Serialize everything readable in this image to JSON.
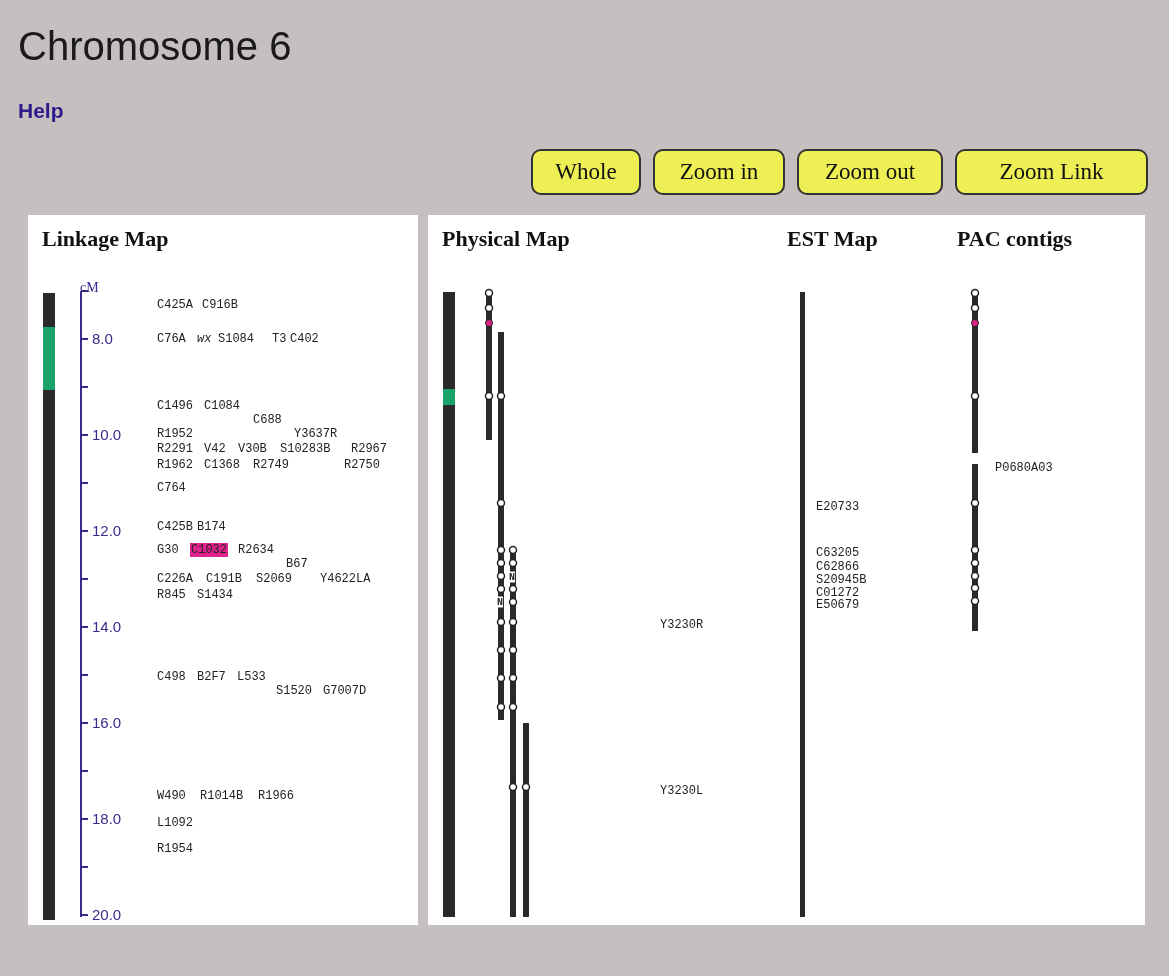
{
  "title": "Chromosome 6",
  "help_link": "Help",
  "buttons": [
    "Whole",
    "Zoom in",
    "Zoom out",
    "Zoom Link"
  ],
  "linkage_map": {
    "title": "Linkage Map",
    "axis_unit": "cM",
    "axis_labels": [
      "8.0",
      "10.0",
      "12.0",
      "14.0",
      "16.0",
      "18.0",
      "20.0"
    ],
    "marker_rows": [
      [
        {
          "label": "C425A",
          "selected": false,
          "italic": false
        },
        {
          "label": "C916B",
          "selected": false,
          "italic": false
        }
      ],
      [
        {
          "label": "C76A",
          "selected": false,
          "italic": false
        },
        {
          "label": "wx",
          "selected": false,
          "italic": true
        },
        {
          "label": "S1084",
          "selected": false,
          "italic": false
        },
        {
          "label": "T3",
          "selected": false,
          "italic": false
        },
        {
          "label": "C402",
          "selected": false,
          "italic": false
        }
      ],
      [
        {
          "label": "C1496",
          "selected": false,
          "italic": false
        },
        {
          "label": "C1084",
          "selected": false,
          "italic": false
        }
      ],
      [
        {
          "label": "C688",
          "selected": false,
          "italic": false
        }
      ],
      [
        {
          "label": "R1952",
          "selected": false,
          "italic": false
        },
        {
          "label": "Y3637R",
          "selected": false,
          "italic": false
        }
      ],
      [
        {
          "label": "R2291",
          "selected": false,
          "italic": false
        },
        {
          "label": "V42",
          "selected": false,
          "italic": false
        },
        {
          "label": "V30B",
          "selected": false,
          "italic": false
        },
        {
          "label": "S10283B",
          "selected": false,
          "italic": false
        },
        {
          "label": "R2967",
          "selected": false,
          "italic": false
        }
      ],
      [
        {
          "label": "R1962",
          "selected": false,
          "italic": false
        },
        {
          "label": "C1368",
          "selected": false,
          "italic": false
        },
        {
          "label": "R2749",
          "selected": false,
          "italic": false
        },
        {
          "label": "R2750",
          "selected": false,
          "italic": false
        }
      ],
      [
        {
          "label": "C764",
          "selected": false,
          "italic": false
        }
      ],
      [
        {
          "label": "C425B",
          "selected": false,
          "italic": false
        },
        {
          "label": "B174",
          "selected": false,
          "italic": false
        }
      ],
      [
        {
          "label": "G30",
          "selected": false,
          "italic": false
        },
        {
          "label": "C1032",
          "selected": true,
          "italic": false
        },
        {
          "label": "R2634",
          "selected": false,
          "italic": false
        }
      ],
      [
        {
          "label": "B67",
          "selected": false,
          "italic": false
        }
      ],
      [
        {
          "label": "C226A",
          "selected": false,
          "italic": false
        },
        {
          "label": "C191B",
          "selected": false,
          "italic": false
        },
        {
          "label": "S2069",
          "selected": false,
          "italic": false
        },
        {
          "label": "Y4622LA",
          "selected": false,
          "italic": false
        }
      ],
      [
        {
          "label": "R845",
          "selected": false,
          "italic": false
        },
        {
          "label": "S1434",
          "selected": false,
          "italic": false
        }
      ],
      [
        {
          "label": "C498",
          "selected": false,
          "italic": false
        },
        {
          "label": "B2F7",
          "selected": false,
          "italic": false
        },
        {
          "label": "L533",
          "selected": false,
          "italic": false
        }
      ],
      [
        {
          "label": "S1520",
          "selected": false,
          "italic": false
        },
        {
          "label": "G7007D",
          "selected": false,
          "italic": false
        }
      ],
      [
        {
          "label": "W490",
          "selected": false,
          "italic": false
        },
        {
          "label": "R1014B",
          "selected": false,
          "italic": false
        },
        {
          "label": "R1966",
          "selected": false,
          "italic": false
        }
      ],
      [
        {
          "label": "L1092",
          "selected": false,
          "italic": false
        }
      ],
      [
        {
          "label": "R1954",
          "selected": false,
          "italic": false
        }
      ]
    ]
  },
  "physical_map": {
    "title": "Physical Map",
    "gap_labels": [
      "N",
      "N"
    ],
    "markers": [
      "Y3230R",
      "Y3230L"
    ]
  },
  "est_map": {
    "title": "EST Map",
    "markers": [
      "E20733",
      "C63205",
      "C62866",
      "S20945B",
      "C01272",
      "E50679"
    ]
  },
  "pac_contigs": {
    "title": "PAC contigs",
    "markers": [
      "P0680A03"
    ]
  }
}
